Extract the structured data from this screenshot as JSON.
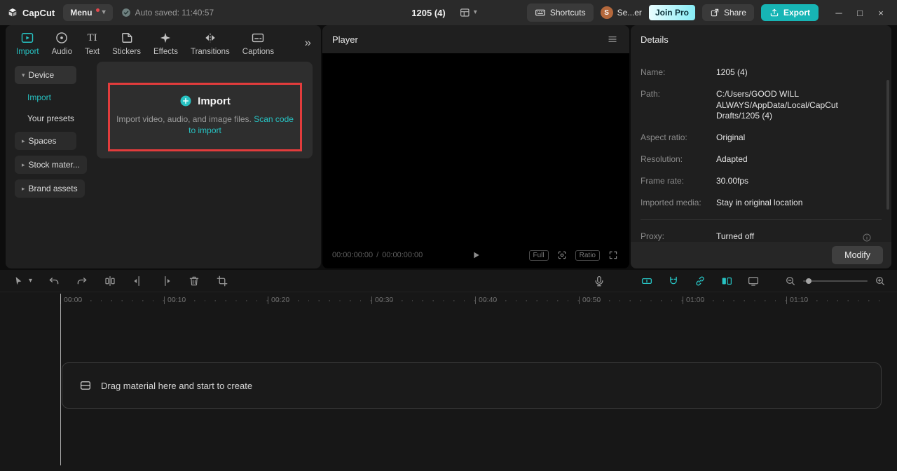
{
  "icons": {
    "chevrons_expand": "»",
    "caret_down": "▾",
    "caret_right": "▸",
    "minimize": "─",
    "maximize": "□",
    "close": "×",
    "text_tab_glyph": "TI"
  },
  "titlebar": {
    "app_name": "CapCut",
    "menu_label": "Menu",
    "autosave_text": "Auto saved: 11:40:57",
    "project_title": "1205 (4)",
    "shortcuts_label": "Shortcuts",
    "user_name": "Se...er",
    "avatar_initial": "S",
    "join_pro_label": "Join Pro",
    "share_label": "Share",
    "export_label": "Export"
  },
  "media_panel": {
    "tabs": [
      {
        "label": "Import"
      },
      {
        "label": "Audio"
      },
      {
        "label": "Text"
      },
      {
        "label": "Stickers"
      },
      {
        "label": "Effects"
      },
      {
        "label": "Transitions"
      },
      {
        "label": "Captions"
      }
    ],
    "sidebar": {
      "device": "Device",
      "import": "Import",
      "your_presets": "Your presets",
      "spaces": "Spaces",
      "stock_material": "Stock mater...",
      "brand_assets": "Brand assets"
    },
    "import_card": {
      "button_label": "Import",
      "description": "Import video, audio, and image files.",
      "link_label": "Scan code to import"
    }
  },
  "player": {
    "title": "Player",
    "timecode_current": "00:00:00:00",
    "timecode_separator": "/",
    "timecode_total": "00:00:00:00",
    "full_label": "Full",
    "ratio_label": "Ratio"
  },
  "details": {
    "title": "Details",
    "rows": [
      {
        "label": "Name:",
        "value": "1205 (4)"
      },
      {
        "label": "Path:",
        "value": "C:/Users/GOOD WILL ALWAYS/AppData/Local/CapCut Drafts/1205 (4)"
      },
      {
        "label": "Aspect ratio:",
        "value": "Original"
      },
      {
        "label": "Resolution:",
        "value": "Adapted"
      },
      {
        "label": "Frame rate:",
        "value": "30.00fps"
      },
      {
        "label": "Imported media:",
        "value": "Stay in original location"
      },
      {
        "label": "Proxy:",
        "value": "Turned off"
      }
    ],
    "modify_label": "Modify"
  },
  "timeline": {
    "ticks": [
      "00:00",
      "00:10",
      "00:20",
      "00:30",
      "00:40",
      "00:50",
      "01:00",
      "01:10"
    ],
    "empty_message": "Drag material here and start to create"
  },
  "colors": {
    "accent_teal": "#27c2c2",
    "highlight_red": "#e23c3c"
  }
}
